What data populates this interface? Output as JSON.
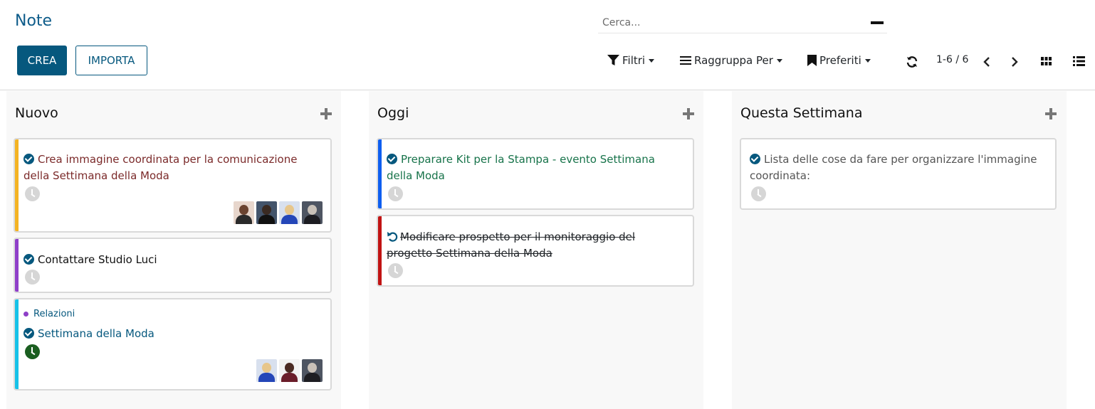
{
  "header": {
    "title": "Note",
    "create_label": "CREA",
    "import_label": "IMPORTA",
    "search_placeholder": "Cerca...",
    "filters_label": "Filtri",
    "groupby_label": "Raggruppa Per",
    "favorites_label": "Preferiti",
    "pager": "1-6 / 6"
  },
  "columns": [
    {
      "title": "Nuovo",
      "cards": [
        {
          "title": "Crea immagine coordinata per la comunicazione della Settimana della Moda",
          "stripe_color": "#f4b323",
          "text_color": "#7b2a2a",
          "avatars": 4
        },
        {
          "title": "Contattare Studio Luci",
          "stripe_color": "#8f3fc9",
          "text_color": "#111111",
          "avatars": 0
        },
        {
          "tag": "Relazioni",
          "title": "Settimana della Moda",
          "stripe_color": "#16c2e8",
          "text_color": "#06587e",
          "activity": "green",
          "avatars": 3
        }
      ]
    },
    {
      "title": "Oggi",
      "cards": [
        {
          "title": "Preparare Kit per la Stampa - evento Settimana della Moda",
          "stripe_color": "#0d5ef0",
          "text_color": "#17734a"
        },
        {
          "title": "Modificare prospetto per il monitoraggio del progetto Settimana della Moda",
          "stripe_color": "#c11313",
          "text_color": "#212529",
          "done": true
        }
      ]
    },
    {
      "title": "Questa Settimana",
      "cards": [
        {
          "title": "Lista delle cose da fare per organizzare l'immagine coordinata:",
          "stripe_color": "",
          "text_color": "#555555"
        }
      ]
    }
  ]
}
